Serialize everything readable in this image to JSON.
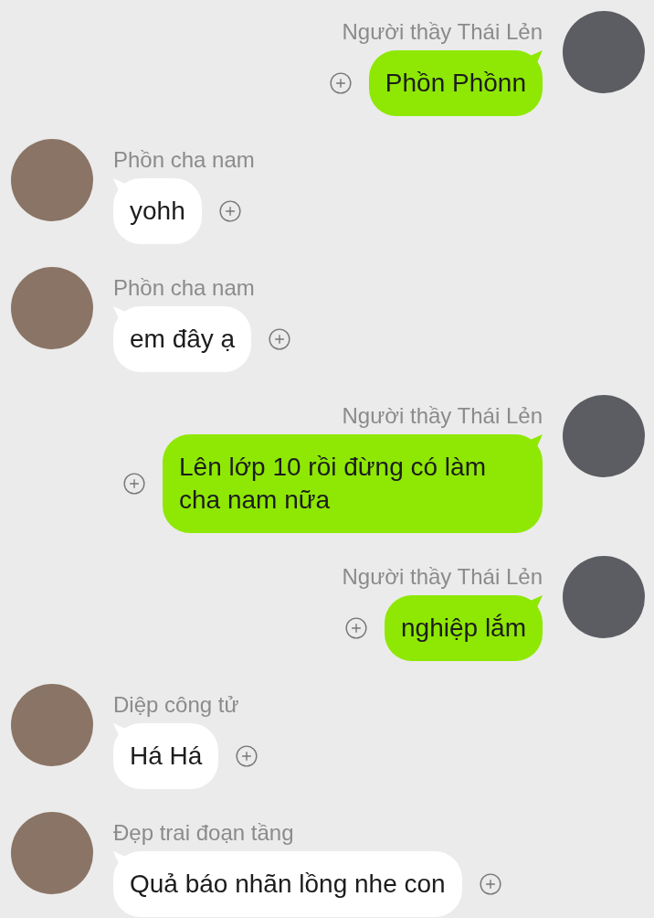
{
  "messages": [
    {
      "kind": "sent",
      "sender": "Người thầy Thái Lẻn",
      "text": "Phồn Phồnn"
    },
    {
      "kind": "received",
      "sender": "Phồn cha nam",
      "text": "yohh"
    },
    {
      "kind": "received",
      "sender": "Phồn cha nam",
      "text": "em đây ạ"
    },
    {
      "kind": "sent",
      "sender": "Người thầy Thái Lẻn",
      "text": "Lên lớp 10 rồi đừng có làm cha nam nữa"
    },
    {
      "kind": "sent",
      "sender": "Người thầy Thái Lẻn",
      "text": "nghiệp lắm"
    },
    {
      "kind": "received",
      "sender": "Diệp công tử",
      "text": "Há Há"
    },
    {
      "kind": "received",
      "sender": "Đẹp trai đoạn tầng",
      "text": "Quả báo nhãn lồng nhe con"
    }
  ]
}
